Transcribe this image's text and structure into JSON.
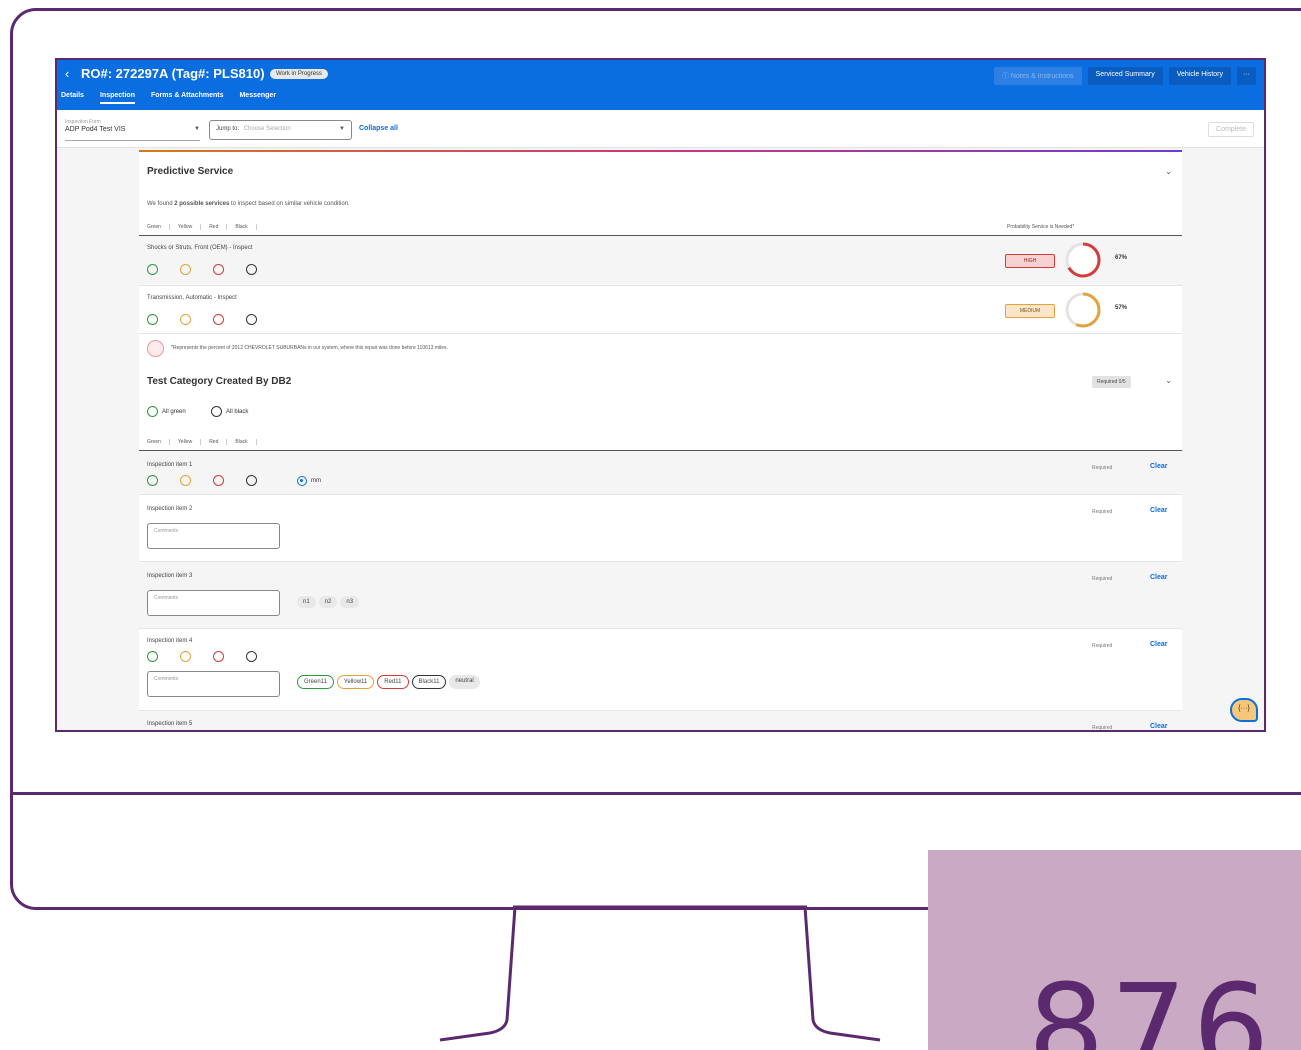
{
  "header": {
    "back_icon": "chevron-left-icon",
    "title": "RO#: 272297A (Tag#: PLS810)",
    "status_badge": "Work in Progress",
    "tabs": [
      {
        "label": "Details",
        "active": false
      },
      {
        "label": "Inspection",
        "active": true
      },
      {
        "label": "Forms & Attachments",
        "active": false
      },
      {
        "label": "Messenger",
        "active": false
      }
    ],
    "actions": {
      "notes": "Notes & Instructions",
      "serviced_summary": "Serviced Summary",
      "vehicle_history": "Vehicle History",
      "more": "···"
    }
  },
  "toolbar": {
    "form_label": "Inspection Form",
    "form_value": "ADP Pod4 Test VIS",
    "jump_label": "Jump to:",
    "jump_placeholder": "Choose Selection",
    "collapse_all": "Collapse all",
    "complete": "Complete"
  },
  "predictive": {
    "title": "Predictive Service",
    "found_prefix": "We found ",
    "found_bold": "2 possible services",
    "found_suffix": " to inspect based on similar vehicle condition.",
    "legend": [
      "Green",
      "Yellow",
      "Red",
      "Black"
    ],
    "probability_header": "Probability Service is Needed*",
    "items": [
      {
        "label": "Shocks or Struts, Front (OEM) - Inspect",
        "level": "HIGH",
        "percent": 67,
        "color": "#d43c3c"
      },
      {
        "label": "Transmission, Automatic - Inspect",
        "level": "MEDIUM",
        "percent": 57,
        "color": "#e2a43a"
      }
    ],
    "pct_labels": [
      "67%",
      "57%"
    ],
    "footnote": "*Represents the percent of 2012 CHEVROLET SUBURBANs in our system, where this repair was done before 110613 miles."
  },
  "test_category": {
    "title": "Test Category Created By DB2",
    "required_pill": "Required 0/5",
    "all_green": "All green",
    "all_black": "All black",
    "legend": [
      "Green",
      "Yellow",
      "Red",
      "Black"
    ],
    "items": [
      {
        "label": "Inspection item 1",
        "required": "Required",
        "clear": "Clear",
        "unit": "mm"
      },
      {
        "label": "Inspection item 2",
        "required": "Required",
        "clear": "Clear",
        "comments": "Comments"
      },
      {
        "label": "Inspection item 3",
        "required": "Required",
        "clear": "Clear",
        "comments": "Comments",
        "chips": [
          "n1",
          "n2",
          "n3"
        ]
      },
      {
        "label": "Inspection item 4",
        "required": "Required",
        "clear": "Clear",
        "comments": "Comments",
        "chips": [
          "Green11",
          "Yellow11",
          "Red11",
          "Black11",
          "neutral"
        ]
      },
      {
        "label": "Inspection item 5",
        "required": "Required",
        "clear": "Clear"
      }
    ]
  },
  "floating_button": "{···}",
  "accent_text": "876",
  "colors": {
    "brand_blue": "#0a6de0",
    "frame_purple": "#5b2a6e",
    "accent_pink": "#c9a9c3",
    "green": "#2e9b3a",
    "yellow": "#e2a43a",
    "red": "#d43c3c",
    "black": "#333333"
  }
}
